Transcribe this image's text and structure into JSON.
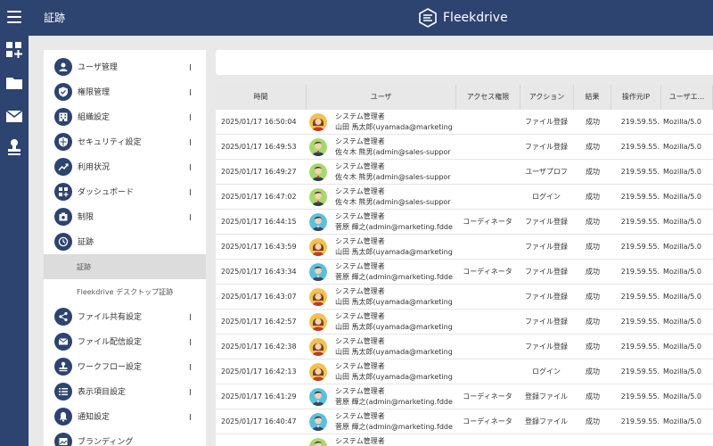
{
  "header": {
    "title": "証跡",
    "brand": "Fleekdrive"
  },
  "rail": {
    "icons": [
      "dashboard-add-icon",
      "folder-icon",
      "mail-icon",
      "stamp-icon"
    ]
  },
  "menu": {
    "items": [
      {
        "label": "ユーザ管理",
        "icon": "user-icon",
        "chevron": true
      },
      {
        "label": "権限管理",
        "icon": "shield-check-icon",
        "chevron": true
      },
      {
        "label": "組織設定",
        "icon": "building-icon",
        "chevron": true
      },
      {
        "label": "セキュリティ設定",
        "icon": "security-shield-icon",
        "chevron": true
      },
      {
        "label": "利用状況",
        "icon": "trending-icon",
        "chevron": true
      },
      {
        "label": "ダッシュボード",
        "icon": "dashboard-add-icon",
        "chevron": true
      },
      {
        "label": "制限",
        "icon": "restriction-icon",
        "chevron": true
      },
      {
        "label": "証跡",
        "icon": "clock-icon",
        "chevron": false
      },
      {
        "label": "ファイル共有設定",
        "icon": "share-icon",
        "chevron": true
      },
      {
        "label": "ファイル配信設定",
        "icon": "mail-icon",
        "chevron": true
      },
      {
        "label": "ワークフロー設定",
        "icon": "stamp-icon",
        "chevron": true
      },
      {
        "label": "表示項目設定",
        "icon": "list-icon",
        "chevron": true
      },
      {
        "label": "通知設定",
        "icon": "bell-icon",
        "chevron": true
      },
      {
        "label": "ブランディング",
        "icon": "branding-icon",
        "chevron": false
      }
    ],
    "sub_items": [
      {
        "label": "証跡",
        "active": true
      },
      {
        "label": "Fleekdrive デスクトップ証跡",
        "active": false
      }
    ]
  },
  "table": {
    "columns": [
      "時間",
      "ユーザ",
      "アクセス権限",
      "アクション",
      "結果",
      "操作元IP",
      "ユーザエ..."
    ],
    "rows": [
      {
        "time": "2025/01/17 16:50:04",
        "role": "システム管理者",
        "name": "山田 馬太郎(uyamada@marketing",
        "avatar": "woman",
        "access": "",
        "action": "ファイル登録",
        "result": "成功",
        "ip": "219.59.55.",
        "ua": "Mozilla/5.0"
      },
      {
        "time": "2025/01/17 16:49:53",
        "role": "システム管理者",
        "name": "佐々木 熊男(admin@sales-suppor",
        "avatar": "man",
        "access": "",
        "action": "ファイル登録",
        "result": "成功",
        "ip": "219.59.55.",
        "ua": "Mozilla/5.0"
      },
      {
        "time": "2025/01/17 16:49:27",
        "role": "システム管理者",
        "name": "佐々木 熊男(admin@sales-suppor",
        "avatar": "man",
        "access": "",
        "action": "ユーザプロフ",
        "result": "成功",
        "ip": "219.59.55.",
        "ua": "Mozilla/5.0"
      },
      {
        "time": "2025/01/17 16:47:02",
        "role": "システム管理者",
        "name": "佐々木 熊男(admin@sales-suppor",
        "avatar": "man",
        "access": "",
        "action": "ログイン",
        "result": "成功",
        "ip": "219.59.55.",
        "ua": "Mozilla/5.0"
      },
      {
        "time": "2025/01/17 16:44:15",
        "role": "システム管理者",
        "name": "菅原 輝之(admin@marketing.fdde",
        "avatar": "teal",
        "access": "コーディネータ",
        "action": "ファイル登録",
        "result": "成功",
        "ip": "219.59.55.",
        "ua": "Mozilla/5.0"
      },
      {
        "time": "2025/01/17 16:43:59",
        "role": "システム管理者",
        "name": "山田 馬太郎(uyamada@marketing",
        "avatar": "woman",
        "access": "",
        "action": "ファイル登録",
        "result": "成功",
        "ip": "219.59.55.",
        "ua": "Mozilla/5.0"
      },
      {
        "time": "2025/01/17 16:43:34",
        "role": "システム管理者",
        "name": "菅原 輝之(admin@marketing.fdde",
        "avatar": "teal",
        "access": "コーディネータ",
        "action": "ファイル登録",
        "result": "成功",
        "ip": "219.59.55.",
        "ua": "Mozilla/5.0"
      },
      {
        "time": "2025/01/17 16:43:07",
        "role": "システム管理者",
        "name": "山田 馬太郎(uyamada@marketing",
        "avatar": "woman",
        "access": "",
        "action": "ファイル登録",
        "result": "成功",
        "ip": "219.59.55.",
        "ua": "Mozilla/5.0"
      },
      {
        "time": "2025/01/17 16:42:57",
        "role": "システム管理者",
        "name": "山田 馬太郎(uyamada@marketing",
        "avatar": "woman",
        "access": "",
        "action": "ファイル登録",
        "result": "成功",
        "ip": "219.59.55.",
        "ua": "Mozilla/5.0"
      },
      {
        "time": "2025/01/17 16:42:38",
        "role": "システム管理者",
        "name": "山田 馬太郎(uyamada@marketing",
        "avatar": "woman",
        "access": "",
        "action": "ファイル登録",
        "result": "成功",
        "ip": "219.59.55.",
        "ua": "Mozilla/5.0"
      },
      {
        "time": "2025/01/17 16:42:13",
        "role": "システム管理者",
        "name": "山田 馬太郎(uyamada@marketing",
        "avatar": "woman",
        "access": "",
        "action": "ログイン",
        "result": "成功",
        "ip": "219.59.55.",
        "ua": "Mozilla/5.0"
      },
      {
        "time": "2025/01/17 16:41:29",
        "role": "システム管理者",
        "name": "菅原 輝之(admin@marketing.fdde",
        "avatar": "teal",
        "access": "コーディネータ",
        "action": "登録ファイル",
        "result": "成功",
        "ip": "219.59.55.",
        "ua": "Mozilla/5.0"
      },
      {
        "time": "2025/01/17 16:40:47",
        "role": "システム管理者",
        "name": "菅原 輝之(admin@marketing.fdde",
        "avatar": "teal",
        "access": "コーディネータ",
        "action": "登録ファイル",
        "result": "成功",
        "ip": "219.59.55.",
        "ua": "Mozilla/5.0"
      },
      {
        "time": "",
        "role": "システム管理者",
        "name": "",
        "avatar": "man",
        "access": "",
        "action": "",
        "result": "",
        "ip": "",
        "ua": ""
      }
    ]
  },
  "colors": {
    "primary": "#2d4370",
    "background": "#e9e9e9",
    "active_sub": "#dcdcdc",
    "header_row": "#e8e8e8"
  }
}
